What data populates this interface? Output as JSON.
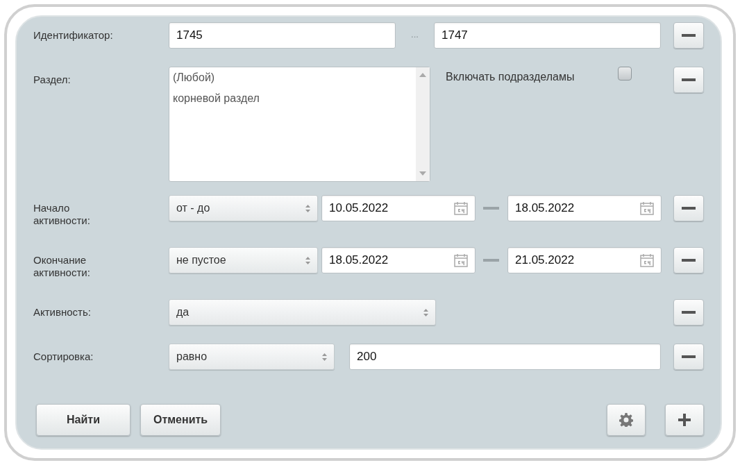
{
  "filters": [
    {
      "kind": "range",
      "label": "Идентификатор:",
      "from": "1745",
      "separator": "...",
      "to": "1747"
    },
    {
      "kind": "list",
      "label": "Раздел:",
      "options": [
        {
          "text": "(Любой)",
          "selected": false
        },
        {
          "text": "корневой раздел",
          "selected": false
        }
      ],
      "checkbox": {
        "label": "Включать подразделамы",
        "checked": false
      }
    },
    {
      "kind": "dates",
      "label": "Начало\nактивности:",
      "mode": "от - до",
      "from": "10.05.2022",
      "to": "18.05.2022"
    },
    {
      "kind": "dates",
      "label": "Окончание\nактивности:",
      "mode": "не пустое",
      "from": "18.05.2022",
      "to": "21.05.2022"
    },
    {
      "kind": "select",
      "label": "Активность:",
      "value": "да"
    },
    {
      "kind": "compare",
      "label": "Сортировка:",
      "mode": "равно",
      "value": "200"
    }
  ],
  "buttons": [
    "Найти",
    "Отменить"
  ]
}
